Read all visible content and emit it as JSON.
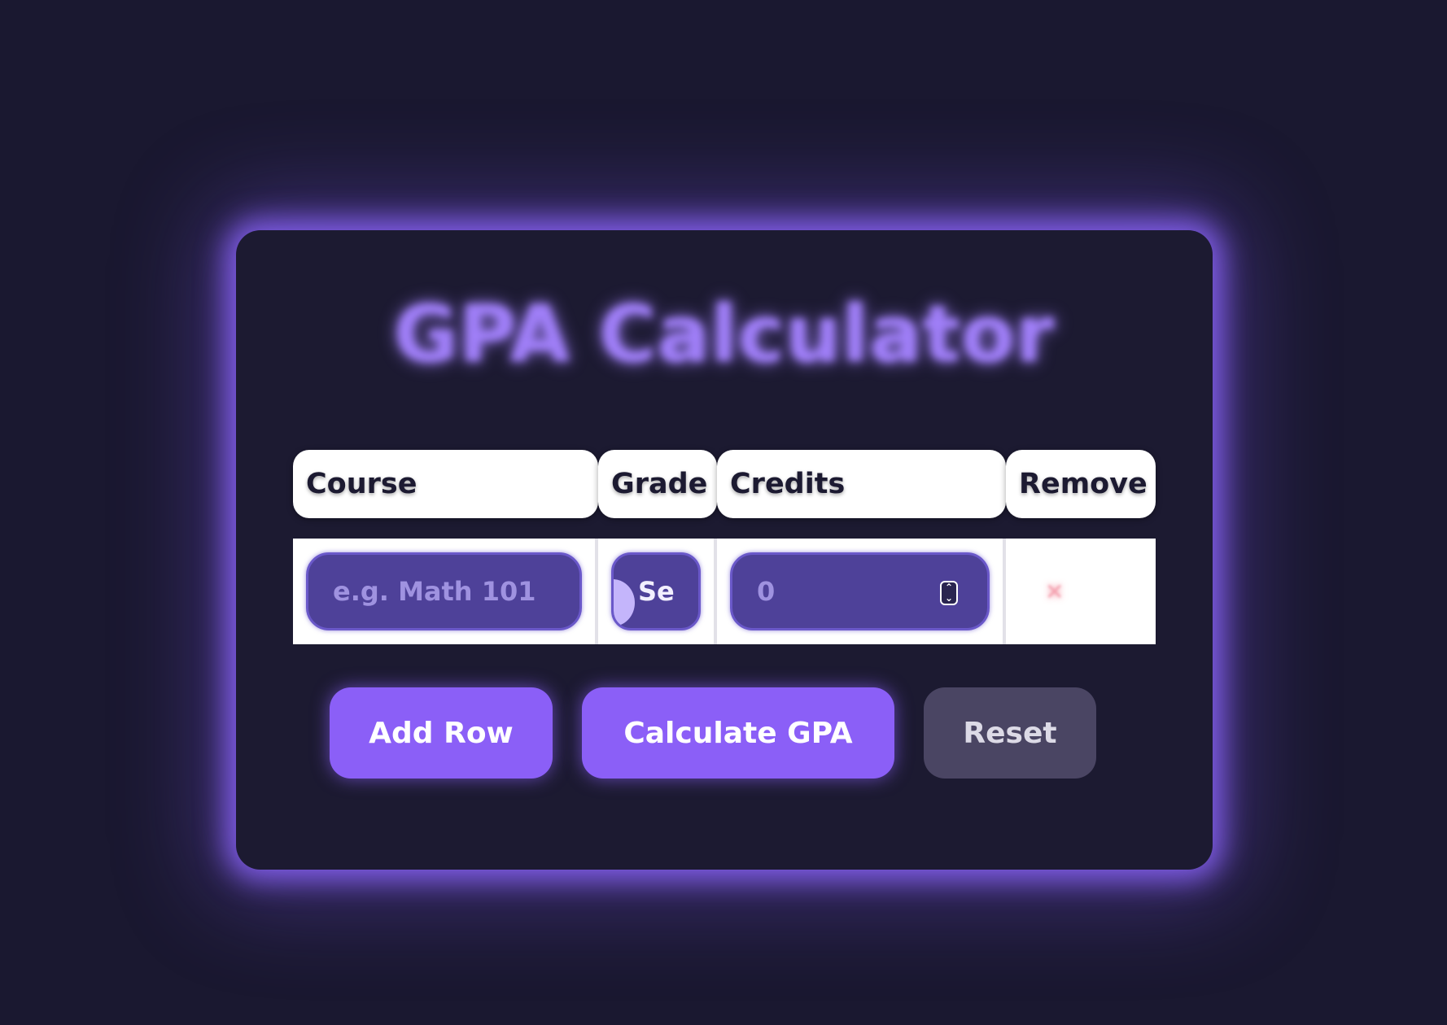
{
  "app": {
    "title": "GPA Calculator"
  },
  "table": {
    "headers": [
      "Course",
      "Grade",
      "Credits",
      "Remove"
    ],
    "rows": [
      {
        "course_placeholder": "e.g. Math 101",
        "grade_value": "Se",
        "credits_value": "0",
        "remove_icon": "close-icon"
      }
    ]
  },
  "buttons": {
    "add_row": "Add Row",
    "calculate": "Calculate GPA",
    "reset": "Reset"
  },
  "colors": {
    "background": "#1a1830",
    "accent": "#8b5ff7",
    "field": "#4e4199",
    "reset": "#4a4563"
  }
}
